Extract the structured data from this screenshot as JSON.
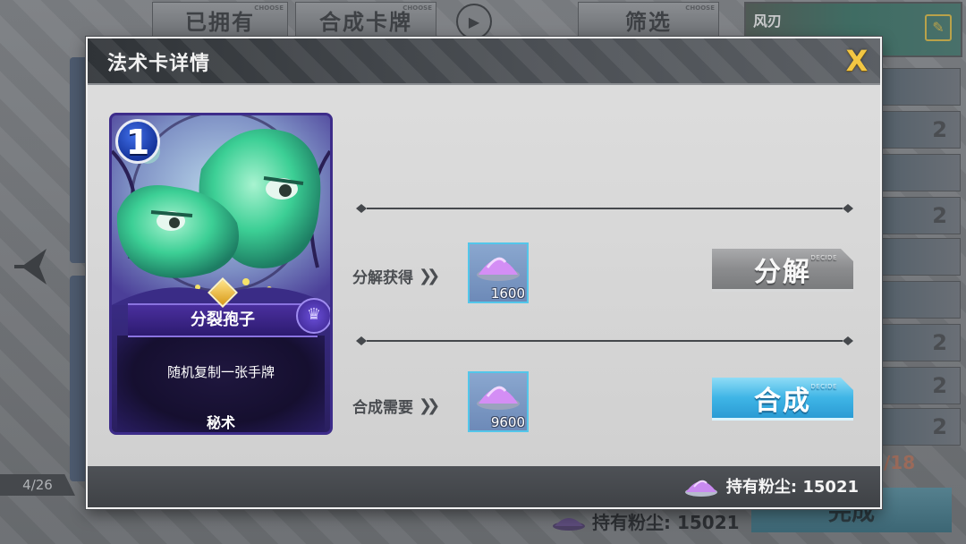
{
  "background": {
    "tabs": [
      {
        "label": "已拥有",
        "tag": "CHOOSE"
      },
      {
        "label": "合成卡牌",
        "tag": "CHOOSE"
      },
      {
        "label": "筛选",
        "tag": "CHOOSE"
      }
    ],
    "play_label": "引导",
    "top_card_name": "风刃",
    "card_count": "4/26",
    "right_list_counts": [
      "2",
      "2",
      "2",
      "2",
      "2",
      "2",
      "2"
    ],
    "progress": "/18",
    "complete_label": "完成",
    "dust_label": "持有粉尘: 15021"
  },
  "modal": {
    "title": "法术卡详情",
    "close_label": "X",
    "card": {
      "cost": "1",
      "name": "分裂孢子",
      "description": "随机复制一张手牌",
      "type": "秘术"
    },
    "disenchant_row": {
      "label": "分解获得",
      "arrows": "»",
      "dust_amount": "1600",
      "button_label": "分解",
      "button_tag": "DECIDE"
    },
    "craft_row": {
      "label": "合成需要",
      "arrows": "»",
      "dust_amount": "9600",
      "button_label": "合成",
      "button_tag": "DECIDE"
    },
    "footer": {
      "dust_label": "持有粉尘: 15021"
    }
  },
  "colors": {
    "modal_header": "#2f3337",
    "close_icon": "#f3c743",
    "craft_button": "#3fb5e6",
    "disenchant_button": "#8b8c8e",
    "card_frame": "#3d2c8a",
    "item_border": "#53c6ea"
  },
  "icons": {
    "close": "close-icon",
    "dust": "dust-pile-icon",
    "arrows": "double-chevron-right-icon",
    "rarity": "rarity-crest-icon",
    "cost": "mana-cost-icon"
  }
}
